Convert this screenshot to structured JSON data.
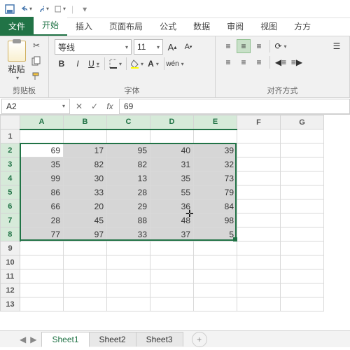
{
  "qat": {
    "save": "💾",
    "undo": "↩",
    "redo": "↪"
  },
  "tabs": {
    "file": "文件",
    "home": "开始",
    "insert": "插入",
    "page": "页面布局",
    "formula": "公式",
    "data": "数据",
    "review": "审阅",
    "view": "视图",
    "square": "方方"
  },
  "ribbon": {
    "clipboard": {
      "paste": "粘贴",
      "label": "剪贴板"
    },
    "font": {
      "name": "等线",
      "size": "11",
      "label": "字体",
      "bold": "B",
      "italic": "I",
      "underline": "U",
      "ruby": "wén"
    },
    "align": {
      "label": "对齐方式"
    }
  },
  "formula_bar": {
    "cell_ref": "A2",
    "value": "69"
  },
  "columns": [
    "A",
    "B",
    "C",
    "D",
    "E",
    "F",
    "G"
  ],
  "rows": [
    1,
    2,
    3,
    4,
    5,
    6,
    7,
    8,
    9,
    10,
    11,
    12,
    13
  ],
  "selection": {
    "active": "A2",
    "range": "A2:E8"
  },
  "chart_data": {
    "type": "table",
    "columns": [
      "A",
      "B",
      "C",
      "D",
      "E"
    ],
    "rows": [
      2,
      3,
      4,
      5,
      6,
      7,
      8
    ],
    "values": [
      [
        69,
        17,
        95,
        40,
        39
      ],
      [
        35,
        82,
        82,
        31,
        32
      ],
      [
        99,
        30,
        13,
        35,
        73
      ],
      [
        86,
        33,
        28,
        55,
        79
      ],
      [
        66,
        20,
        29,
        36,
        84
      ],
      [
        28,
        45,
        88,
        48,
        98
      ],
      [
        77,
        97,
        33,
        37,
        5
      ]
    ]
  },
  "sheets": {
    "s1": "Sheet1",
    "s2": "Sheet2",
    "s3": "Sheet3"
  }
}
